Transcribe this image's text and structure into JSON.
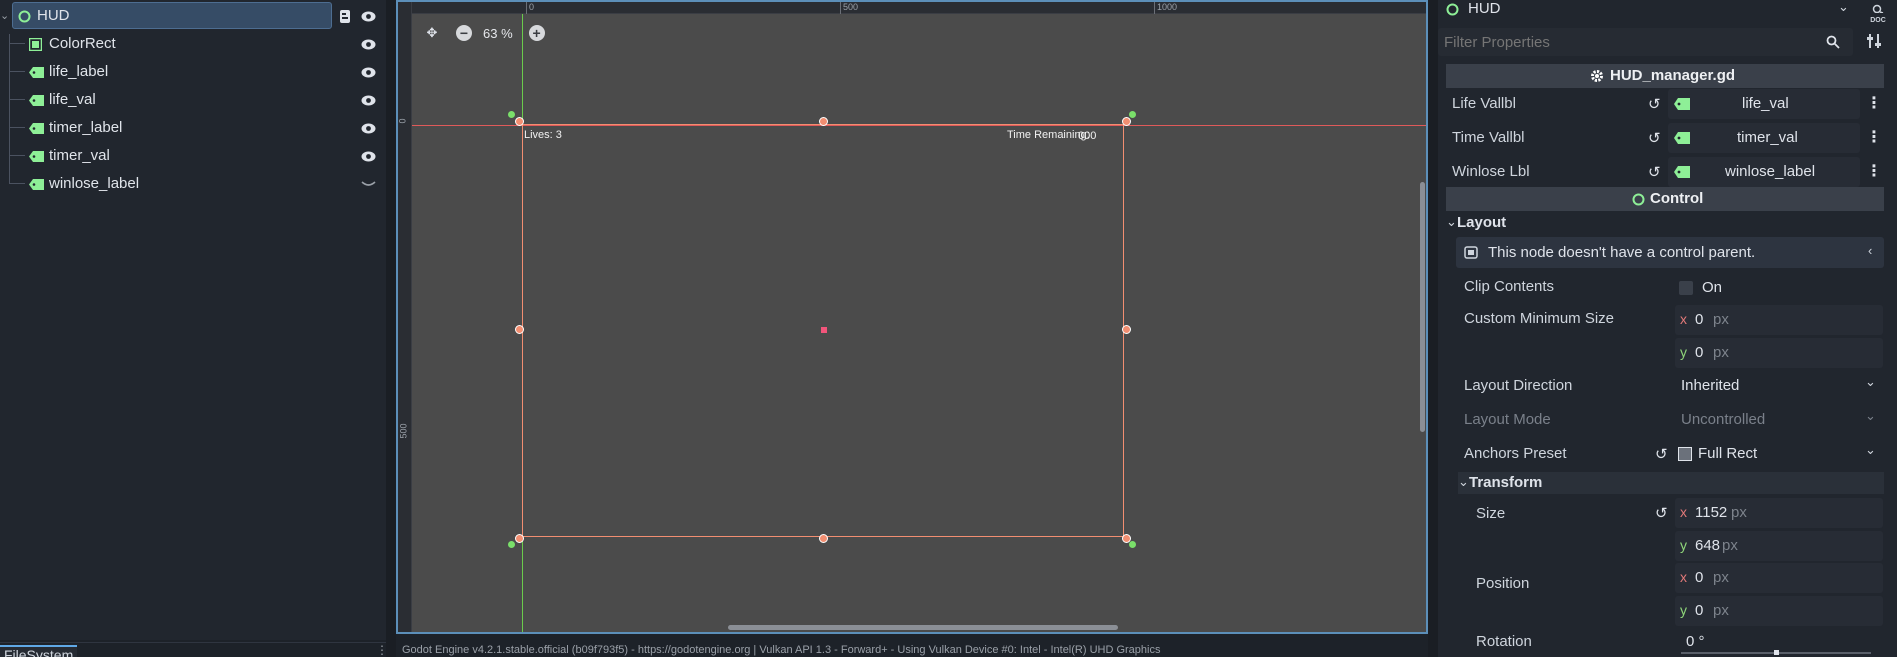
{
  "scene_tree": {
    "root": {
      "label": "HUD"
    },
    "children": [
      {
        "label": "ColorRect",
        "icon": "color-rect-icon",
        "visible": true
      },
      {
        "label": "life_label",
        "icon": "label-icon",
        "visible": true
      },
      {
        "label": "life_val",
        "icon": "label-icon",
        "visible": true
      },
      {
        "label": "timer_label",
        "icon": "label-icon",
        "visible": true
      },
      {
        "label": "timer_val",
        "icon": "label-icon",
        "visible": true
      },
      {
        "label": "winlose_label",
        "icon": "label-icon",
        "visible": false
      }
    ],
    "bottom_tab": "FileSystem"
  },
  "viewport": {
    "zoom": "63 %",
    "ruler_top": [
      "0",
      "500",
      "1000"
    ],
    "ruler_left": [
      "0",
      "500"
    ],
    "canvas_texts": {
      "lives": "Lives: 3",
      "time_label": "Time Remaining:",
      "time_val": "000"
    },
    "status_line": "Godot Engine v4.2.1.stable.official (b09f793f5) - https://godotengine.org | Vulkan API 1.3 - Forward+ - Using Vulkan Device #0: Intel - Intel(R) UHD Graphics"
  },
  "inspector": {
    "node_name": "HUD",
    "filter_placeholder": "Filter Properties",
    "script_name": "HUD_manager.gd",
    "script_props": [
      {
        "label": "Life Vallbl",
        "value": "life_val"
      },
      {
        "label": "Time Vallbl",
        "value": "timer_val"
      },
      {
        "label": "Winlose Lbl",
        "value": "winlose_label"
      }
    ],
    "class_header": "Control",
    "layout_section": "Layout",
    "warning": "This node doesn't have a control parent.",
    "clip_contents": {
      "label": "Clip Contents",
      "value": "On"
    },
    "custom_min_size": {
      "label": "Custom Minimum Size",
      "x": "0",
      "y": "0",
      "unit": "px"
    },
    "layout_direction": {
      "label": "Layout Direction",
      "value": "Inherited"
    },
    "layout_mode": {
      "label": "Layout Mode",
      "value": "Uncontrolled"
    },
    "anchors_preset": {
      "label": "Anchors Preset",
      "value": "Full Rect"
    },
    "transform_section": "Transform",
    "size": {
      "label": "Size",
      "x": "1152",
      "y": "648",
      "unit": "px"
    },
    "position": {
      "label": "Position",
      "x": "0",
      "y": "0",
      "unit": "px"
    },
    "rotation": {
      "label": "Rotation",
      "value": "0 °"
    },
    "axis_x": "x",
    "axis_y": "y",
    "doc_label": "DOC"
  },
  "colors": {
    "accent": "#5fa8e6",
    "node_green": "#8eef97",
    "selection_orange": "#f28e71",
    "guide_red": "#ff5a5a",
    "guide_green": "#5aff5a"
  }
}
